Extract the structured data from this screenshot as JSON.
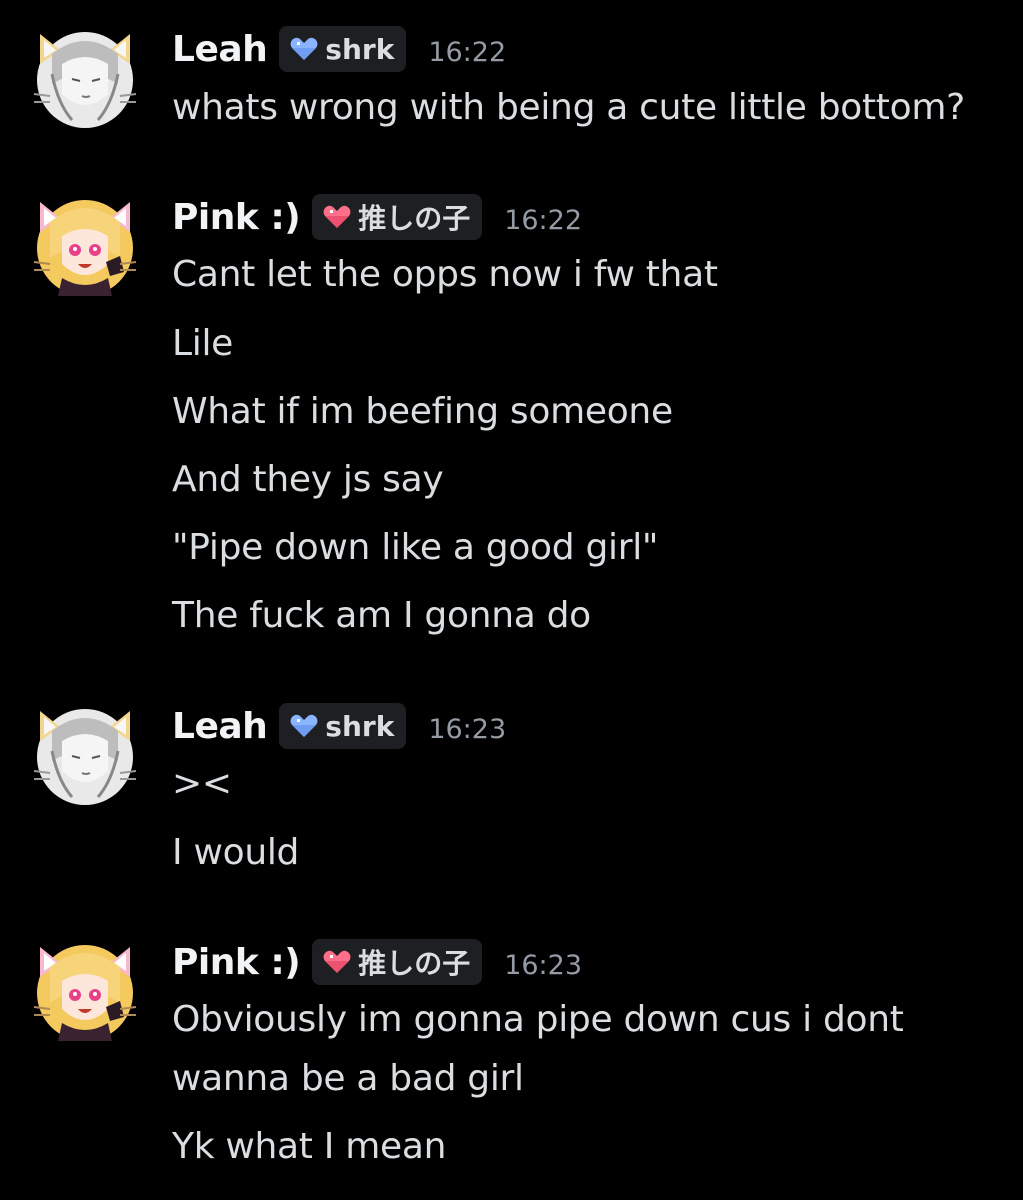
{
  "messages": [
    {
      "username": "Leah",
      "tag": "shrk",
      "tag_icon": "blue-heart-icon",
      "tag_color": "#8ab4ff",
      "timestamp": "16:22",
      "avatar": "cat-ear-avatar-monochrome",
      "lines": [
        "whats wrong with being a cute little bottom?"
      ]
    },
    {
      "username": "Pink :)",
      "tag": "推しの子",
      "tag_icon": "pink-heart-icon",
      "tag_color": "#ff6f8a",
      "timestamp": "16:22",
      "avatar": "cat-ear-avatar-blonde",
      "lines": [
        "Cant let the opps now i fw that",
        "Lile",
        "What if im beefing someone",
        "And they js say",
        "\"Pipe down like a good girl\"",
        "The fuck am I gonna do"
      ]
    },
    {
      "username": "Leah",
      "tag": "shrk",
      "tag_icon": "blue-heart-icon",
      "tag_color": "#8ab4ff",
      "timestamp": "16:23",
      "avatar": "cat-ear-avatar-monochrome",
      "lines": [
        "><",
        "I would"
      ]
    },
    {
      "username": "Pink :)",
      "tag": "推しの子",
      "tag_icon": "pink-heart-icon",
      "tag_color": "#ff6f8a",
      "timestamp": "16:23",
      "avatar": "cat-ear-avatar-blonde",
      "lines": [
        "Obviously im gonna pipe down cus i dont",
        "wanna be a bad girl",
        "Yk what I mean"
      ]
    }
  ]
}
